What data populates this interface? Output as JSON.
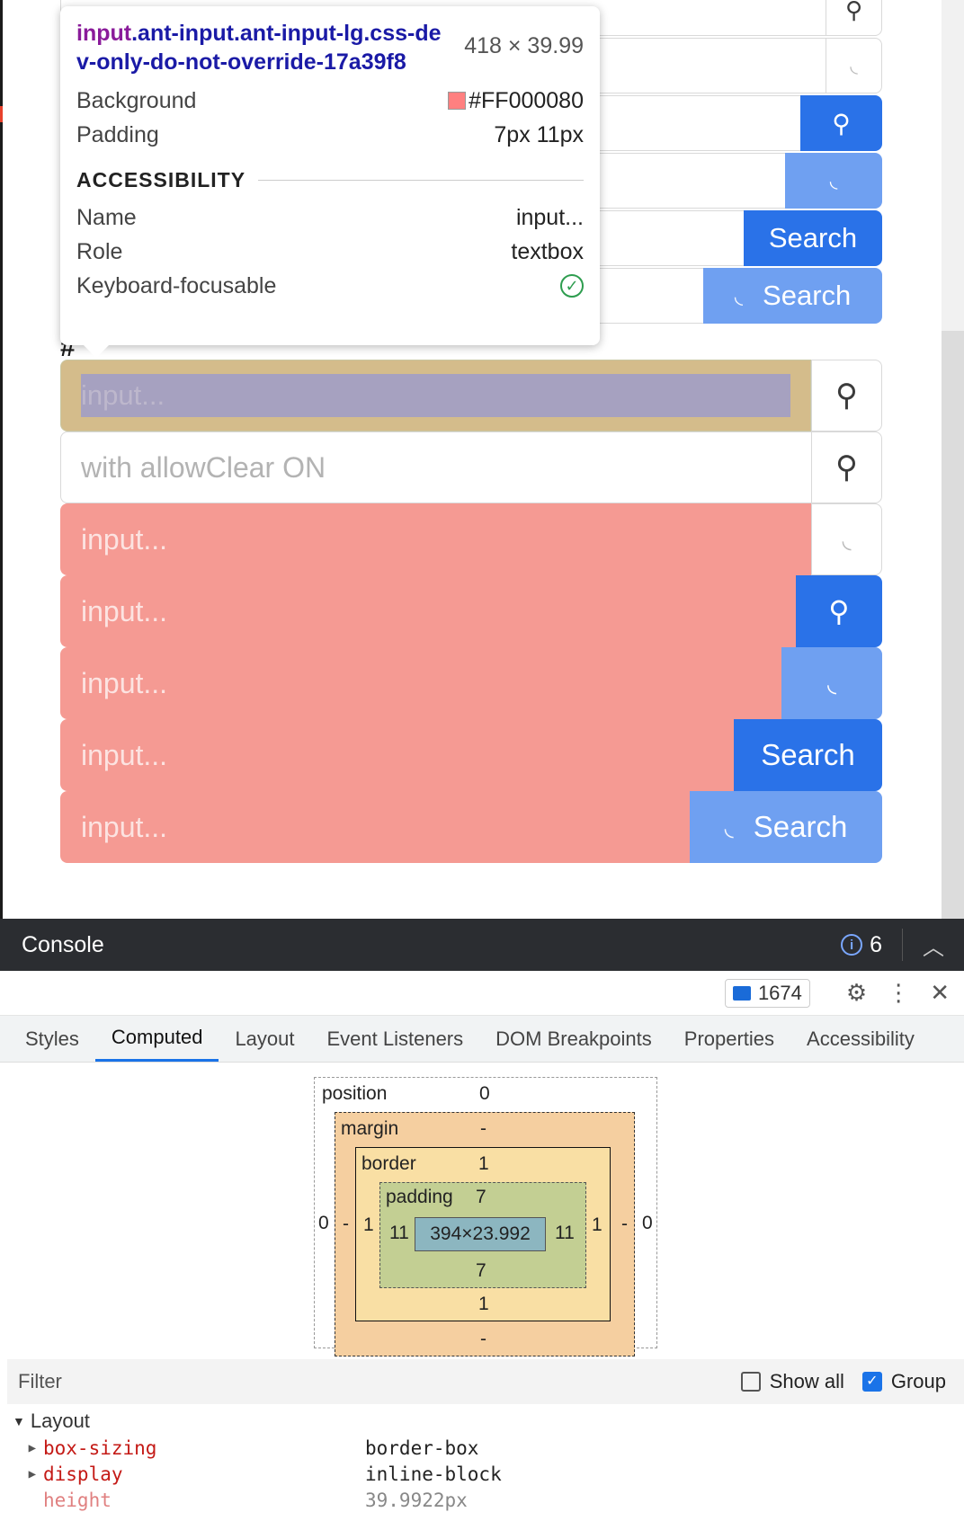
{
  "tooltip": {
    "tag": "input",
    "selector": ".ant-input.ant-input-lg.css-dev-only-do-not-override-17a39f8",
    "size": "418 × 39.99",
    "background_label": "Background",
    "background_value": "#FF000080",
    "padding_label": "Padding",
    "padding_value": "7px 11px",
    "accessibility_heading": "ACCESSIBILITY",
    "name_label": "Name",
    "name_value": "input...",
    "role_label": "Role",
    "role_value": "textbox",
    "focusable_label": "Keyboard-focusable"
  },
  "top_rows": [
    {
      "button": "search-icon"
    },
    {
      "button": "loading-icon"
    },
    {
      "button": "search-icon",
      "primary": true
    },
    {
      "button": "loading-icon",
      "primary": true
    },
    {
      "button": "Search",
      "primary": true
    },
    {
      "button": "Search",
      "loading": true
    }
  ],
  "section_label": "# large",
  "large_rows": {
    "row1_placeholder": "input...",
    "row2_placeholder": "with allowClear ON",
    "row3_placeholder": "input...",
    "row4_placeholder": "input...",
    "row5_placeholder": "input...",
    "row6_placeholder": "input...",
    "row6_button": "Search",
    "row7_placeholder": "input...",
    "row7_button": "Search"
  },
  "top_buttons": {
    "search5": "Search",
    "search6": "Search"
  },
  "console": {
    "title": "Console",
    "info_count": "6"
  },
  "devtools": {
    "messages_count": "1674",
    "tabs": [
      "Styles",
      "Computed",
      "Layout",
      "Event Listeners",
      "DOM Breakpoints",
      "Properties",
      "Accessibility"
    ],
    "active_tab": "Computed",
    "box_model": {
      "position_label": "position",
      "position_value": "0",
      "position_left": "0",
      "position_right": "0",
      "margin_label": "margin",
      "margin_top": "-",
      "margin_bottom": "-",
      "margin_left": "-",
      "margin_right": "-",
      "border_label": "border",
      "border_top": "1",
      "border_bottom": "1",
      "border_left": "1",
      "border_right": "1",
      "padding_label": "padding",
      "padding_top": "7",
      "padding_bottom": "7",
      "padding_left": "11",
      "padding_right": "11",
      "content": "394×23.992"
    },
    "filter_label": "Filter",
    "show_all_label": "Show all",
    "group_label": "Group",
    "group_heading": "Layout",
    "properties": [
      {
        "name": "box-sizing",
        "value": "border-box"
      },
      {
        "name": "display",
        "value": "inline-block"
      },
      {
        "name": "height",
        "value": "39.9922px"
      }
    ]
  }
}
